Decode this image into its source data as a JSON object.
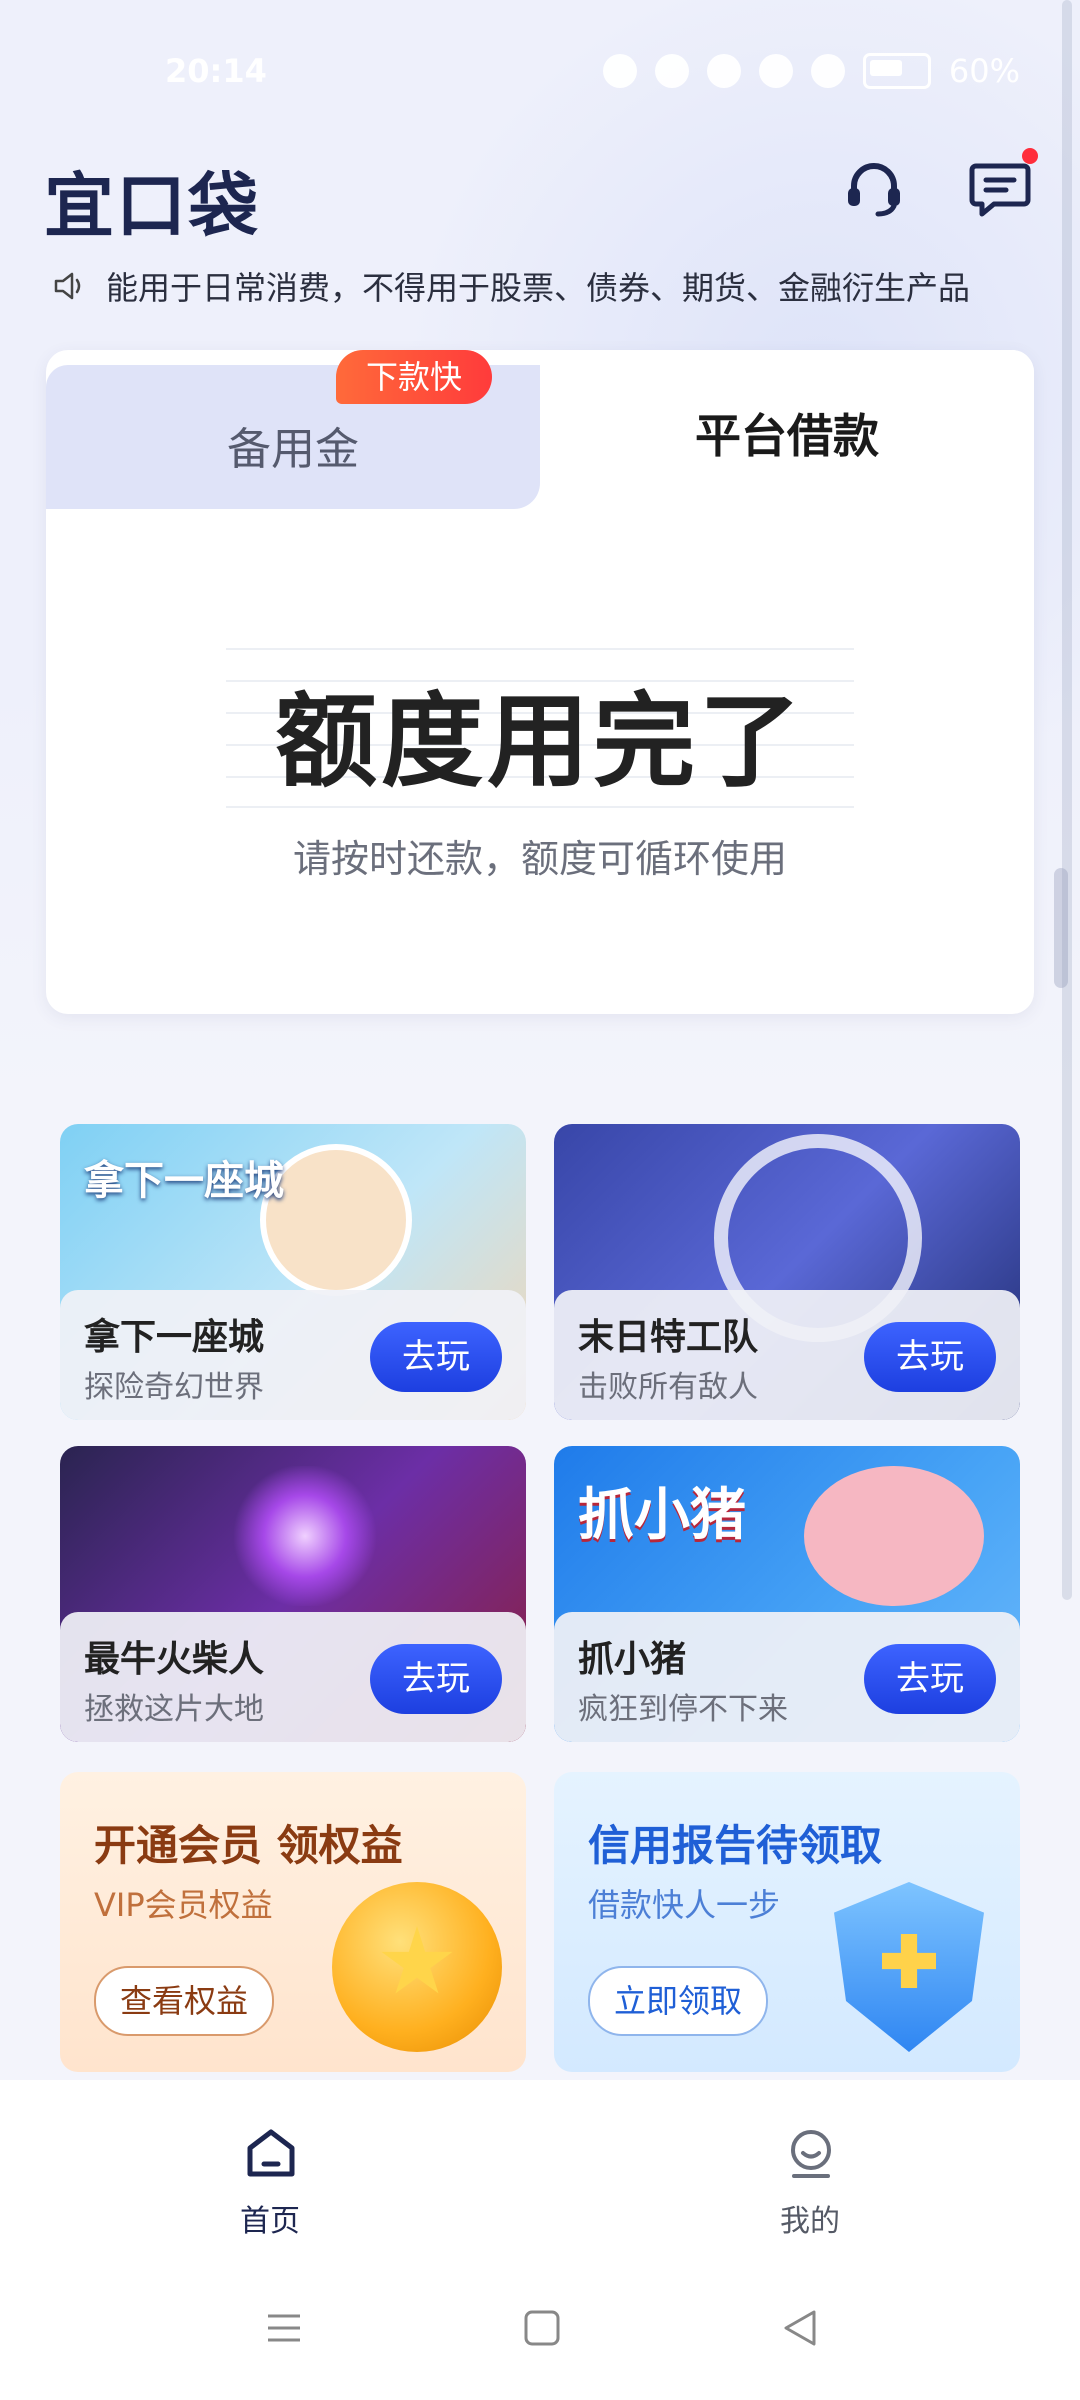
{
  "status_bar": {
    "time": "20:14",
    "battery": "60%"
  },
  "app": {
    "logo": "宜口袋"
  },
  "notice": {
    "text": "能用于日常消费，不得用于股票、债券、期货、金融衍生产品"
  },
  "tabs": {
    "left": {
      "label": "备用金",
      "badge": "下款快"
    },
    "right": {
      "label": "平台借款"
    }
  },
  "quota": {
    "title": "额度用完了",
    "subtitle": "请按时还款，额度可循环使用"
  },
  "games": [
    {
      "tag": "拿下一座城",
      "name": "拿下一座城",
      "desc": "探险奇幻世界",
      "button": "去玩"
    },
    {
      "tag": "",
      "name": "末日特工队",
      "desc": "击败所有敌人",
      "button": "去玩"
    },
    {
      "tag": "",
      "name": "最牛火柴人",
      "desc": "拯救这片大地",
      "button": "去玩"
    },
    {
      "tag": "抓小猪",
      "name": "抓小猪",
      "desc": "疯狂到停不下来",
      "button": "去玩"
    }
  ],
  "promos": [
    {
      "title": "开通会员 领权益",
      "subtitle": "VIP会员权益",
      "button": "查看权益"
    },
    {
      "title": "信用报告待领取",
      "subtitle": "借款快人一步",
      "button": "立即领取"
    }
  ],
  "bottom_nav": [
    {
      "label": "首页",
      "icon": "home-icon",
      "active": true
    },
    {
      "label": "我的",
      "icon": "profile-icon",
      "active": false
    }
  ],
  "colors": {
    "brand": "#1d2650",
    "play_button": "#2a4df0",
    "badge": "#ff4a3a"
  }
}
